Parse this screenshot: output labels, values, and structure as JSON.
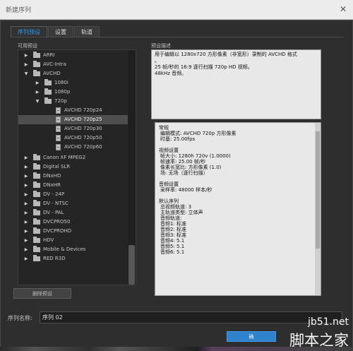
{
  "window": {
    "title": "新建序列",
    "close_icon": "close-icon"
  },
  "tabs": [
    {
      "label": "序列预设",
      "active": true
    },
    {
      "label": "设置",
      "active": false
    },
    {
      "label": "轨道",
      "active": false
    }
  ],
  "left": {
    "section_label": "可用预设",
    "tree": [
      {
        "label": "ARRI",
        "type": "folder",
        "state": "collapsed",
        "level": 0
      },
      {
        "label": "AVC-Intra",
        "type": "folder",
        "state": "collapsed",
        "level": 0
      },
      {
        "label": "AVCHD",
        "type": "folder",
        "state": "expanded",
        "level": 0
      },
      {
        "label": "1080i",
        "type": "folder",
        "state": "collapsed",
        "level": 1
      },
      {
        "label": "1080p",
        "type": "folder",
        "state": "collapsed",
        "level": 1
      },
      {
        "label": "720p",
        "type": "folder",
        "state": "expanded",
        "level": 1
      },
      {
        "label": "AVCHD 720p24",
        "type": "preset",
        "state": "none",
        "level": 2
      },
      {
        "label": "AVCHD 720p25",
        "type": "preset",
        "state": "selected",
        "level": 2
      },
      {
        "label": "AVCHD 720p30",
        "type": "preset",
        "state": "none",
        "level": 2
      },
      {
        "label": "AVCHD 720p50",
        "type": "preset",
        "state": "none",
        "level": 2
      },
      {
        "label": "AVCHD 720p60",
        "type": "preset",
        "state": "none",
        "level": 2
      },
      {
        "label": "Canon XF MPEG2",
        "type": "folder",
        "state": "collapsed",
        "level": 0
      },
      {
        "label": "Digital SLR",
        "type": "folder",
        "state": "collapsed",
        "level": 0
      },
      {
        "label": "DNxHD",
        "type": "folder",
        "state": "collapsed",
        "level": 0
      },
      {
        "label": "DNxHR",
        "type": "folder",
        "state": "collapsed",
        "level": 0
      },
      {
        "label": "DV - 24P",
        "type": "folder",
        "state": "collapsed",
        "level": 0
      },
      {
        "label": "DV - NTSC",
        "type": "folder",
        "state": "collapsed",
        "level": 0
      },
      {
        "label": "DV - PAL",
        "type": "folder",
        "state": "collapsed",
        "level": 0
      },
      {
        "label": "DVCPRO50",
        "type": "folder",
        "state": "collapsed",
        "level": 0
      },
      {
        "label": "DVCPROHD",
        "type": "folder",
        "state": "collapsed",
        "level": 0
      },
      {
        "label": "HDV",
        "type": "folder",
        "state": "collapsed",
        "level": 0
      },
      {
        "label": "Mobile & Devices",
        "type": "folder",
        "state": "collapsed",
        "level": 0
      },
      {
        "label": "RED R3D",
        "type": "folder",
        "state": "collapsed",
        "level": 0
      }
    ],
    "delete_button": "删除预设"
  },
  "right": {
    "section_label": "预设描述",
    "description_lines": [
      "用于编辑以 1280x720 方形像素（非宽形）录制的 AVCHD 格式",
      "。",
      "25 帧/秒的 16:9 逐行扫描 720p HD 视频。",
      "48kHz 音频。"
    ],
    "details_lines": [
      "常规",
      " 编辑模式: AVCHD 720p 方形像素",
      " 时基: 25.00fps",
      "",
      "视频设置",
      " 帧大小: 1280h 720v (1.0000)",
      " 帧速率: 25.00 帧/秒",
      " 像素长宽比: 方形像素 (1.0)",
      " 场: 无场（逐行扫描）",
      "",
      "音频设置",
      " 采样率: 48000 样本/秒",
      "",
      "默认序列",
      " 总视频轨道: 3",
      " 主轨道类型: 立体声",
      " 音频轨道:",
      " 音频1: 标准",
      " 音频2: 标准",
      " 音频3: 标准",
      " 音频4: 5.1",
      " 音频5: 5.1",
      " 音频6: 5.1"
    ]
  },
  "sequence_name": {
    "label": "序列名称:",
    "value": "序列 02"
  },
  "buttons": {
    "ok": "确"
  },
  "watermark": {
    "url": "jb51.net",
    "name": "脚本之家"
  },
  "colors": {
    "accent": "#2f9cf3",
    "ok_button": "#2f82ce"
  }
}
